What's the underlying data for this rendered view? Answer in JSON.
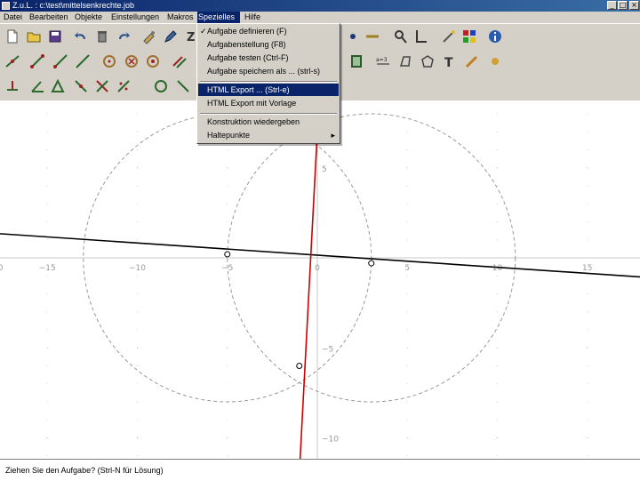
{
  "window": {
    "title": "Z.u.L. : c:\\test\\mittelsenkrechte.job",
    "buttons": [
      "_",
      "□",
      "×"
    ]
  },
  "menubar": {
    "items": [
      "Datei",
      "Bearbeiten",
      "Objekte",
      "Einstellungen",
      "Makros",
      "Spezielles",
      "Hilfe"
    ],
    "active": "Spezielles"
  },
  "dropdown": {
    "items": [
      {
        "label": "Aufgabe definieren (F)",
        "checked": true
      },
      {
        "label": "Aufgabenstellung (F8)"
      },
      {
        "label": "Aufgabe testen (Ctrl-F)"
      },
      {
        "label": "Aufgabe speichern als ... (strl-s)"
      },
      {
        "label": "HTML Export ... (Strl-e)",
        "highlighted": true
      },
      {
        "label": "HTML Export mit Vorlage"
      },
      {
        "label": "Konstruktion wiedergeben"
      },
      {
        "label": "Haltepunkte",
        "submenu": true
      }
    ]
  },
  "toolbar": {
    "row1_icons": [
      "new-file-icon",
      "open-folder-icon",
      "save-disk-icon",
      "undo-icon",
      "delete-icon",
      "redo-icon",
      "hide-icon",
      "edit-icon",
      "z-text-icon",
      "point-icon",
      "segment-icon",
      "zoom-icon",
      "axis-icon",
      "magic-wand-icon",
      "palette-icon",
      "info-icon"
    ],
    "row2_icons": [
      "line-point-icon",
      "segment-point-icon",
      "ray-icon",
      "line-icon",
      "circle-icon",
      "circle-cross-icon",
      "circle-fixed-icon",
      "parallel-icon",
      "triangle-icon",
      "animate-icon",
      "equation-icon",
      "quadrilateral-icon",
      "polygon-icon",
      "text-tool-icon",
      "pencil-icon",
      "star-icon"
    ],
    "row3_icons": [
      "perpendicular-icon",
      "angle-icon",
      "polygon-tool-icon",
      "midpoint-icon",
      "intersection-icon",
      "reflect-icon",
      "circle3-icon",
      "tangent-icon"
    ]
  },
  "chart_data": {
    "type": "scatter",
    "x_ticks": [
      "0",
      "−15",
      "−10",
      "−5",
      "0",
      "5",
      "10",
      "15"
    ],
    "y_ticks": [
      "5",
      "−5",
      "−10"
    ],
    "xlim": [
      -20,
      20
    ],
    "ylim": [
      -11,
      7
    ],
    "grid": "dots",
    "series": [
      {
        "kind": "line",
        "color": "#000000",
        "points": [
          [
            -20,
            1.5
          ],
          [
            20,
            -1.2
          ]
        ]
      },
      {
        "kind": "line",
        "color": "#cc0000",
        "points": [
          [
            -1,
            -12
          ],
          [
            0,
            7
          ]
        ]
      },
      {
        "kind": "circle",
        "color": "#999999",
        "dashed": true,
        "center": [
          -5,
          0
        ],
        "radius": 8
      },
      {
        "kind": "circle",
        "color": "#999999",
        "dashed": true,
        "center": [
          3,
          0
        ],
        "radius": 8
      },
      {
        "kind": "point",
        "x": -5,
        "y": 0.2
      },
      {
        "kind": "point",
        "x": 3,
        "y": -0.3
      },
      {
        "kind": "point",
        "x": -1,
        "y": -6
      },
      {
        "kind": "point",
        "x": 0,
        "y": 6.5
      }
    ]
  },
  "status": {
    "text": "Ziehen Sie den Aufgabe? (Strl-N für Lösung)"
  }
}
